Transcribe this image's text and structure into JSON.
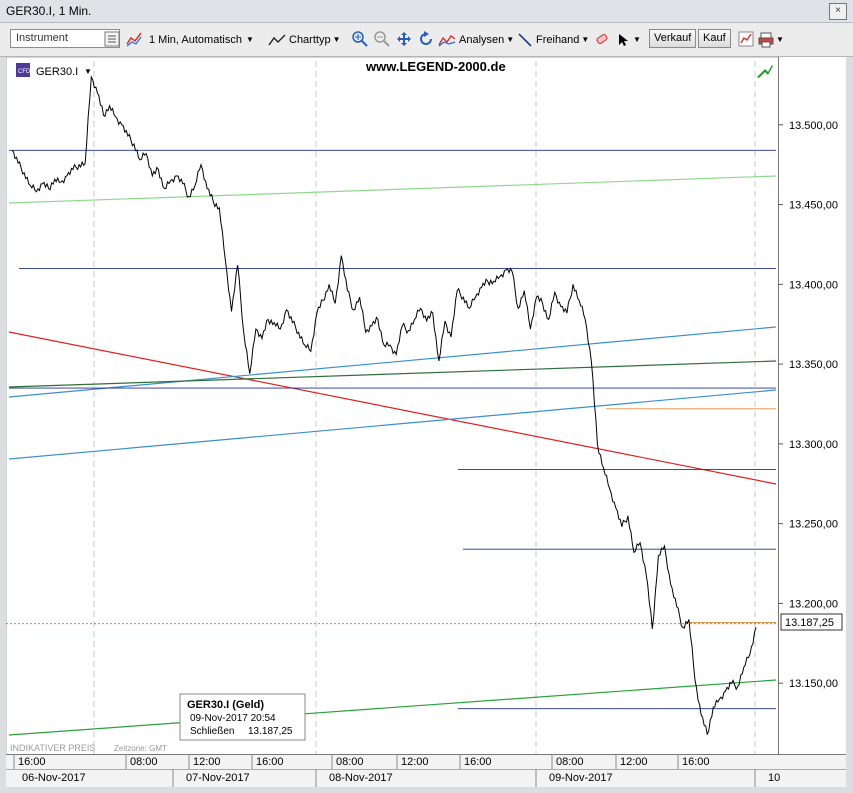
{
  "window": {
    "title": "GER30.I, 1 Min.",
    "close_label": "×"
  },
  "toolbar": {
    "instrument_placeholder": "Instrument",
    "interval_label": "1 Min,  Automatisch",
    "charttype_label": "Charttyp",
    "analysen_label": "Analysen",
    "freihand_label": "Freihand",
    "sell_label": "Verkauf",
    "buy_label": "Kauf"
  },
  "chart_header": {
    "symbol": "GER30.I",
    "badge": "CFD",
    "watermark": "www.LEGEND-2000.de"
  },
  "tooltip": {
    "title": "GER30.I (Geld)",
    "datetime": "09-Nov-2017 20:54",
    "close_label": "Schließen",
    "close_value": "13.187,25"
  },
  "footer": {
    "left": "INDIKATIVER PREIS",
    "tz": "Zeitzone: GMT"
  },
  "current_price_label": "13.187,25",
  "chart_data": {
    "type": "line",
    "series": [
      {
        "name": "GER30.I",
        "values": [
          13484,
          13476,
          13470,
          13462,
          13458,
          13463,
          13460,
          13466,
          13464,
          13468,
          13472,
          13475,
          13476,
          13530,
          13520,
          13506,
          13512,
          13505,
          13500,
          13493,
          13488,
          13478,
          13482,
          13468,
          13472,
          13460,
          13465,
          13468,
          13463,
          13455,
          13462,
          13475,
          13460,
          13452,
          13448,
          13415,
          13383,
          13412,
          13370,
          13344,
          13372,
          13366,
          13378,
          13376,
          13372,
          13384,
          13376,
          13370,
          13362,
          13358,
          13382,
          13390,
          13400,
          13388,
          13418,
          13396,
          13384,
          13392,
          13370,
          13374,
          13378,
          13362,
          13362,
          13356,
          13374,
          13371,
          13378,
          13385,
          13377,
          13382,
          13352,
          13377,
          13367,
          13396,
          13392,
          13385,
          13392,
          13398,
          13402,
          13402,
          13405,
          13409,
          13408,
          13385,
          13396,
          13372,
          13392,
          13388,
          13378,
          13395,
          13386,
          13382,
          13400,
          13390,
          13378,
          13352,
          13300,
          13285,
          13272,
          13260,
          13248,
          13255,
          13232,
          13238,
          13218,
          13184,
          13230,
          13236,
          13212,
          13198,
          13185,
          13190,
          13152,
          13130,
          13118,
          13135,
          13140,
          13145,
          13150,
          13148,
          13160,
          13168,
          13185
        ]
      }
    ],
    "y_axis": {
      "ticks": [
        "13.150,00",
        "13.200,00",
        "13.250,00",
        "13.300,00",
        "13.350,00",
        "13.400,00",
        "13.450,00",
        "13.500,00"
      ],
      "range": [
        13110,
        13540
      ]
    },
    "x_axis": {
      "time_ticks": [
        "16:00",
        "08:00",
        "12:00",
        "16:00",
        "08:00",
        "12:00",
        "16:00",
        "08:00",
        "12:00",
        "16:00"
      ],
      "date_ticks": [
        "06-Nov-2017",
        "07-Nov-2017",
        "08-Nov-2017",
        "09-Nov-2017",
        "10"
      ]
    },
    "horizontal_levels": [
      13484,
      13410,
      13335,
      13284,
      13234,
      13134
    ],
    "short_levels": [
      13322,
      13188
    ]
  }
}
